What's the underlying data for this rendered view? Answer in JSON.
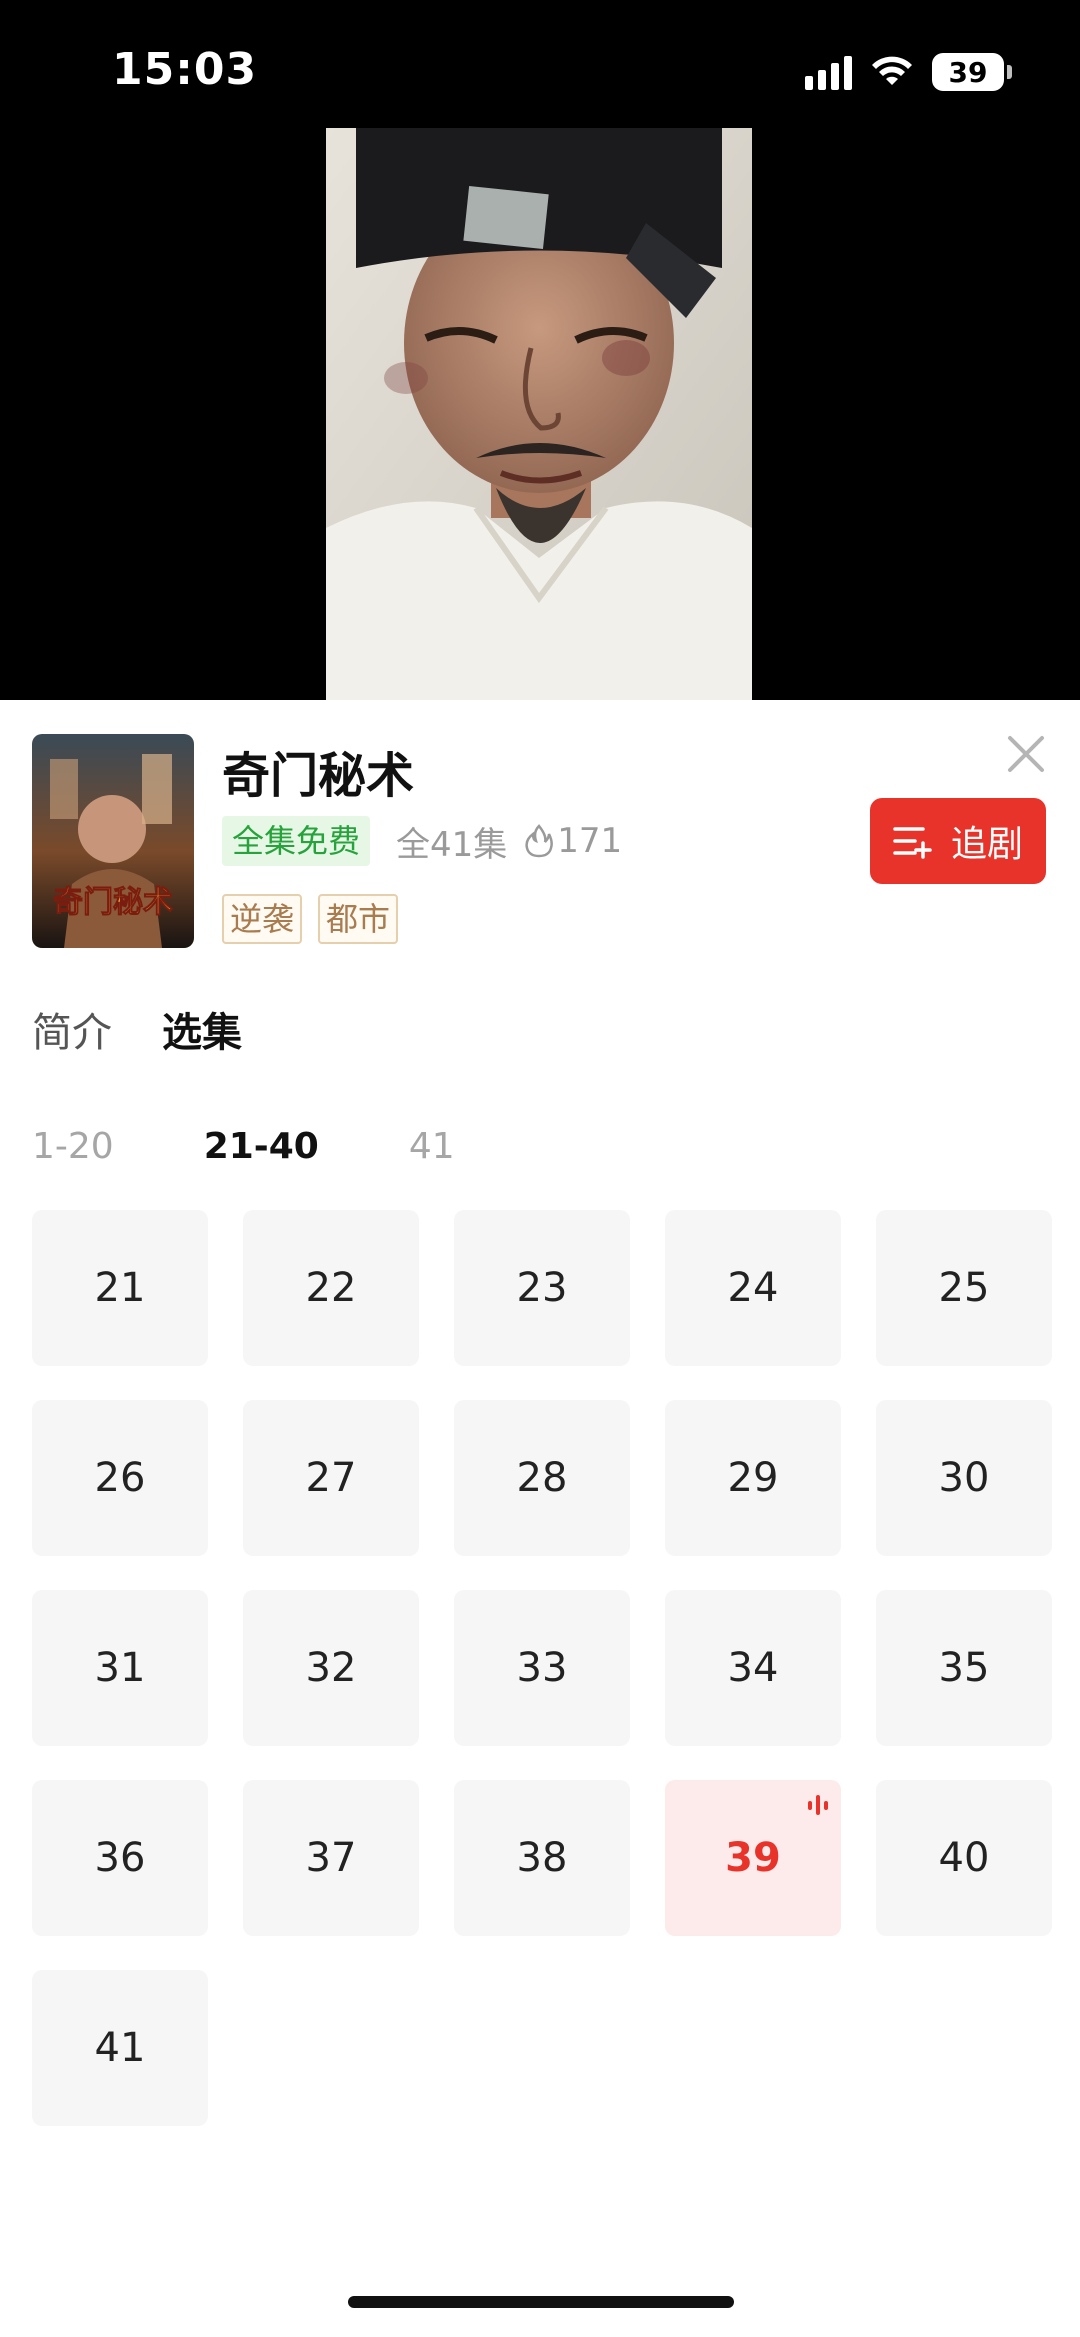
{
  "status": {
    "time": "15:03",
    "battery": "39"
  },
  "drama": {
    "title": "奇门秘术",
    "poster_text": "奇门秘术",
    "free_badge": "全集免费",
    "episodes_total": "全41集",
    "heat": "171",
    "tags": [
      "逆袭",
      "都市"
    ],
    "follow_label": "追剧"
  },
  "tabs": {
    "intro": "简介",
    "episodes": "选集"
  },
  "ranges": [
    "1-20",
    "21-40",
    "41"
  ],
  "active_range": "21-40",
  "episodes": [
    "21",
    "22",
    "23",
    "24",
    "25",
    "26",
    "27",
    "28",
    "29",
    "30",
    "31",
    "32",
    "33",
    "34",
    "35",
    "36",
    "37",
    "38",
    "39",
    "40",
    "41"
  ],
  "current_episode": "39",
  "colors": {
    "accent": "#e8332a",
    "free_green": "#27a33b",
    "tag_brown": "#a87c4f"
  }
}
